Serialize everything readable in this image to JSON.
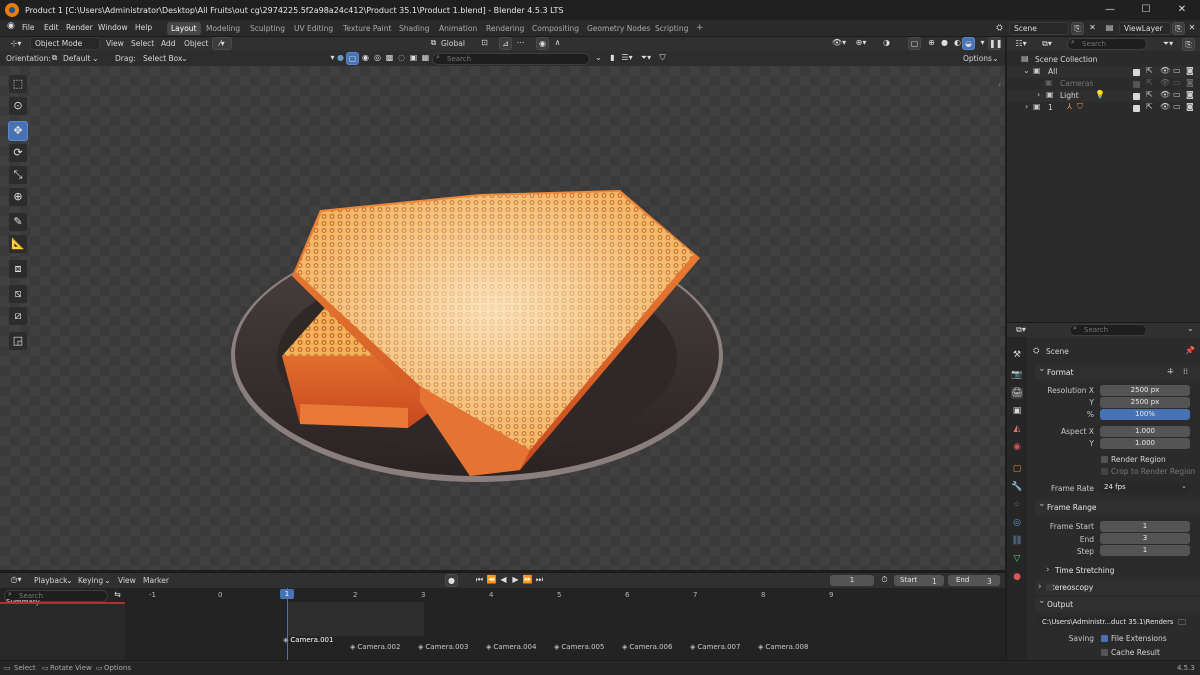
{
  "window": {
    "title": "Product 1 [C:\\Users\\Administrator\\Desktop\\All Fruits\\out cg\\2974225.5f2a98a24c412\\Product 35.1\\Product 1.blend] - Blender 4.5.3 LTS",
    "minimize": "—",
    "maximize": "☐",
    "close": "✕"
  },
  "menu": {
    "file": "File",
    "edit": "Edit",
    "render": "Render",
    "window": "Window",
    "help": "Help"
  },
  "workspaces": [
    "Layout",
    "Modeling",
    "Sculpting",
    "UV Editing",
    "Texture Paint",
    "Shading",
    "Animation",
    "Rendering",
    "Compositing",
    "Geometry Nodes",
    "Scripting"
  ],
  "add_workspace": "+",
  "scene": {
    "name": "Scene",
    "view_layer": "ViewLayer"
  },
  "viewport_header": {
    "mode": "Object Mode",
    "view": "View",
    "select": "Select",
    "add": "Add",
    "object": "Object",
    "transform": "Global",
    "orientation_label": "Orientation:",
    "orientation_value": "Default",
    "drag_label": "Drag:",
    "drag_value": "Select Box",
    "search_placeholder": "Search",
    "options": "Options"
  },
  "tools": [
    "select-box",
    "cursor",
    "move",
    "rotate",
    "scale",
    "transform",
    "annotate",
    "measure",
    "add-cube",
    "tool-1",
    "tool-2",
    "tool-3"
  ],
  "outliner": {
    "search_placeholder": "Search",
    "root": "Scene Collection",
    "items": [
      {
        "label": "All"
      },
      {
        "label": "Cameras"
      },
      {
        "label": "Light"
      },
      {
        "label": "1"
      }
    ]
  },
  "properties": {
    "search_placeholder": "Search",
    "context": "Scene",
    "format": {
      "header": "Format",
      "resolution_x_label": "Resolution X",
      "resolution_x": "2500 px",
      "resolution_y_label": "Y",
      "resolution_y": "2500 px",
      "percent_label": "%",
      "percent": "100%",
      "aspect_x_label": "Aspect X",
      "aspect_x": "1.000",
      "aspect_y_label": "Y",
      "aspect_y": "1.000",
      "render_region": "Render Region",
      "crop_region": "Crop to Render Region",
      "frame_rate_label": "Frame Rate",
      "frame_rate": "24 fps"
    },
    "frame_range": {
      "header": "Frame Range",
      "start_label": "Frame Start",
      "start": "1",
      "end_label": "End",
      "end": "3",
      "step_label": "Step",
      "step": "1"
    },
    "time_stretching": "Time Stretching",
    "stereoscopy": "Stereoscopy",
    "output": {
      "header": "Output",
      "path": "C:\\Users\\Administr...duct 35.1\\Renders",
      "saving_label": "Saving",
      "file_extensions": "File Extensions",
      "cache_result": "Cache Result"
    }
  },
  "timeline": {
    "playback": "Playback",
    "keying": "Keying",
    "view": "View",
    "marker": "Marker",
    "current_frame": "1",
    "start_label": "Start",
    "start": "1",
    "end_label": "End",
    "end": "3",
    "search_placeholder": "Search",
    "summary": "Summary",
    "frames": [
      "-1",
      "0",
      "1",
      "2",
      "3",
      "4",
      "5",
      "6",
      "7",
      "8",
      "9"
    ],
    "playhead_frame": "1",
    "markers": [
      "Camera.001",
      "Camera.002",
      "Camera.003",
      "Camera.004",
      "Camera.005",
      "Camera.006",
      "Camera.007",
      "Camera.008"
    ]
  },
  "status": {
    "select": "Select",
    "rotate": "Rotate View",
    "options": "Options",
    "version": "4.5.3"
  },
  "colors": {
    "accent": "#4772b3",
    "blender_orange": "#e87d0d"
  }
}
